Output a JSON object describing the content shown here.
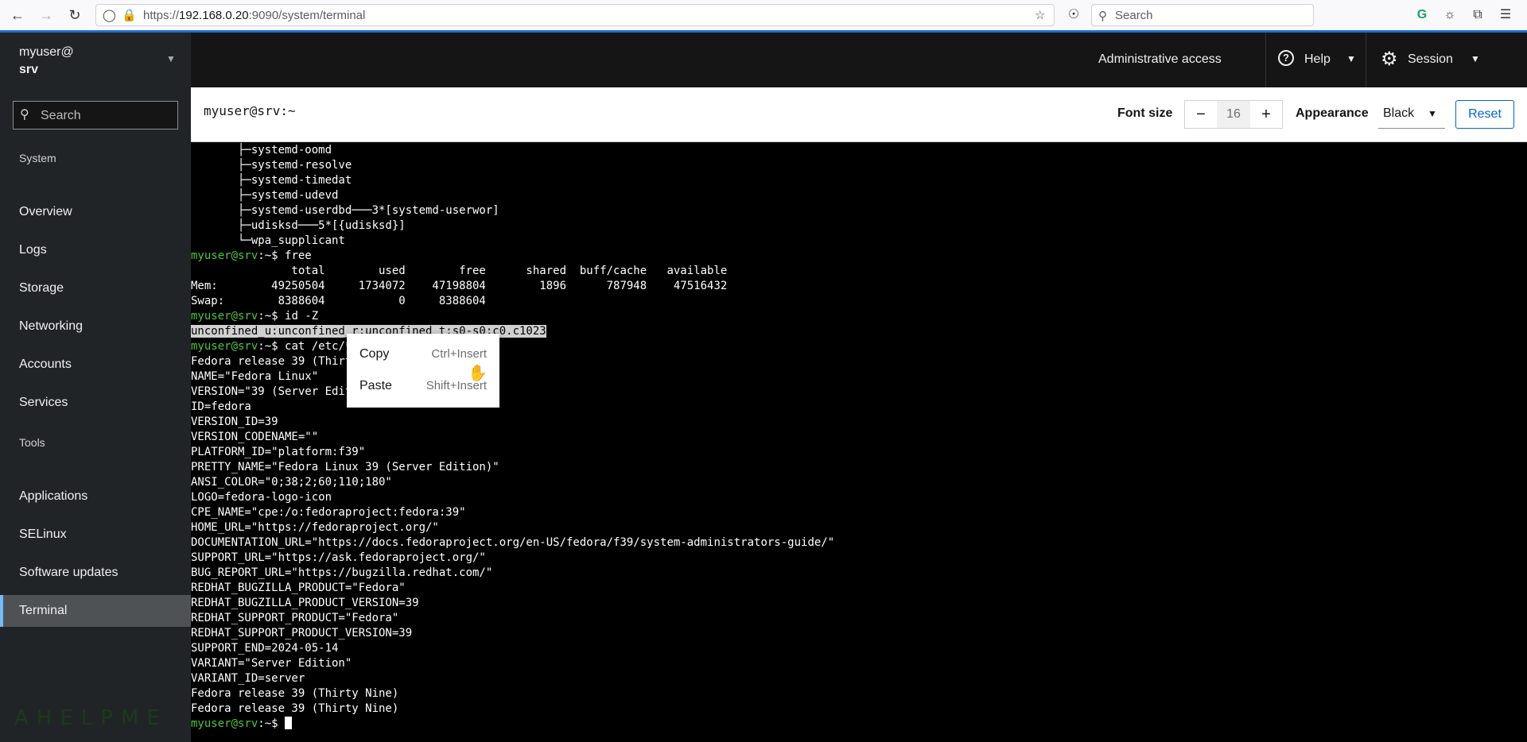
{
  "browser": {
    "url_prefix": "https://",
    "url_host": "192.168.0.20",
    "url_path": ":9090/system/terminal",
    "search_placeholder": "Search"
  },
  "sidebar": {
    "host_user": "myuser@",
    "host_name": "srv",
    "search_placeholder": "Search",
    "system_label": "System",
    "system_items": [
      "Overview",
      "Logs",
      "Storage",
      "Networking",
      "Accounts",
      "Services"
    ],
    "tools_label": "Tools",
    "tools_items": [
      "Applications",
      "SELinux",
      "Software updates",
      "Terminal"
    ],
    "active_item": "Terminal",
    "watermark": "AHELPME"
  },
  "masthead": {
    "admin_access": "Administrative access",
    "help": "Help",
    "session": "Session"
  },
  "toolbar": {
    "title": "myuser@srv:~",
    "font_size_label": "Font size",
    "font_minus": "−",
    "font_size_value": "16",
    "font_plus": "+",
    "appearance_label": "Appearance",
    "appearance_value": "Black",
    "reset": "Reset"
  },
  "terminal": {
    "lines": [
      {
        "text": "       ├─systemd-oomd"
      },
      {
        "text": "       ├─systemd-resolve"
      },
      {
        "text": "       ├─systemd-timedat"
      },
      {
        "text": "       ├─systemd-udevd"
      },
      {
        "text": "       ├─systemd-userdbd───3*[systemd-userwor]"
      },
      {
        "text": "       ├─udisksd───5*[{udisksd}]"
      },
      {
        "text": "       └─wpa_supplicant"
      },
      {
        "prompt": "myuser@srv",
        "path": ":~$ ",
        "text": "free"
      },
      {
        "text": "               total        used        free      shared  buff/cache   available"
      },
      {
        "text": "Mem:        49250504     1734072    47198804        1896      787948    47516432"
      },
      {
        "text": "Swap:        8388604           0     8388604"
      },
      {
        "prompt": "myuser@srv",
        "path": ":~$ ",
        "text": "id -Z"
      },
      {
        "text": "unconfined_u:unconfined_r:unconfined_t:s0-s0:c0.c1023",
        "highlight": true
      },
      {
        "prompt": "myuser@srv",
        "path": ":~$ ",
        "text": "cat /etc/*release"
      },
      {
        "text": "Fedora release 39 (Thirty Nine)"
      },
      {
        "text": "NAME=\"Fedora Linux\""
      },
      {
        "text": "VERSION=\"39 (Server Edition)\""
      },
      {
        "text": "ID=fedora"
      },
      {
        "text": "VERSION_ID=39"
      },
      {
        "text": "VERSION_CODENAME=\"\""
      },
      {
        "text": "PLATFORM_ID=\"platform:f39\""
      },
      {
        "text": "PRETTY_NAME=\"Fedora Linux 39 (Server Edition)\""
      },
      {
        "text": "ANSI_COLOR=\"0;38;2;60;110;180\""
      },
      {
        "text": "LOGO=fedora-logo-icon"
      },
      {
        "text": "CPE_NAME=\"cpe:/o:fedoraproject:fedora:39\""
      },
      {
        "text": "HOME_URL=\"https://fedoraproject.org/\""
      },
      {
        "text": "DOCUMENTATION_URL=\"https://docs.fedoraproject.org/en-US/fedora/f39/system-administrators-guide/\""
      },
      {
        "text": "SUPPORT_URL=\"https://ask.fedoraproject.org/\""
      },
      {
        "text": "BUG_REPORT_URL=\"https://bugzilla.redhat.com/\""
      },
      {
        "text": "REDHAT_BUGZILLA_PRODUCT=\"Fedora\""
      },
      {
        "text": "REDHAT_BUGZILLA_PRODUCT_VERSION=39"
      },
      {
        "text": "REDHAT_SUPPORT_PRODUCT=\"Fedora\""
      },
      {
        "text": "REDHAT_SUPPORT_PRODUCT_VERSION=39"
      },
      {
        "text": "SUPPORT_END=2024-05-14"
      },
      {
        "text": "VARIANT=\"Server Edition\""
      },
      {
        "text": "VARIANT_ID=server"
      },
      {
        "text": "Fedora release 39 (Thirty Nine)"
      },
      {
        "text": "Fedora release 39 (Thirty Nine)"
      },
      {
        "prompt": "myuser@srv",
        "path": ":~$ ",
        "text": "",
        "cursor": true
      }
    ]
  },
  "context_menu": {
    "copy_label": "Copy",
    "copy_shortcut": "Ctrl+Insert",
    "paste_label": "Paste",
    "paste_shortcut": "Shift+Insert"
  },
  "colors": {
    "prompt": "#4fc63a",
    "accent": "#06c",
    "sidebar_bg": "#212427",
    "active_border": "#73bcf7"
  }
}
